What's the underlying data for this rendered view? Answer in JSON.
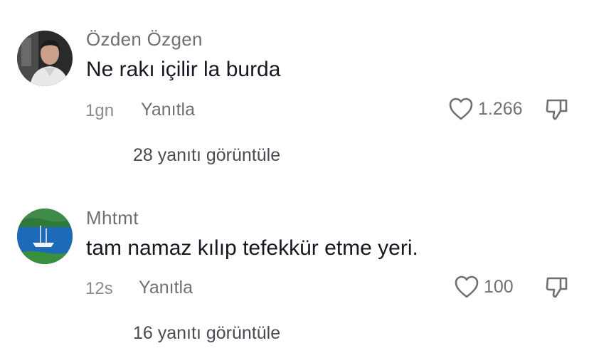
{
  "comments": [
    {
      "username": "Özden Özgen",
      "text": "Ne rakı içilir la burda",
      "time": "1gn",
      "reply_label": "Yanıtla",
      "likes": "1.266",
      "view_replies": "28 yanıtı görüntüle",
      "avatar": "man-portrait-avatar",
      "icons": {
        "like": "heart-outline-icon",
        "dislike": "thumbs-down-icon"
      }
    },
    {
      "username": "Mhtmt",
      "text": "tam namaz kılıp tefekkür etme yeri.",
      "time": "12s",
      "reply_label": "Yanıtla",
      "likes": "100",
      "view_replies": "16 yanıtı görüntüle",
      "avatar": "sea-boat-avatar",
      "icons": {
        "like": "heart-outline-icon",
        "dislike": "thumbs-down-icon"
      }
    }
  ],
  "colors": {
    "text_primary": "#161823",
    "text_secondary": "#6f7072",
    "text_muted": "#8a8b91"
  }
}
